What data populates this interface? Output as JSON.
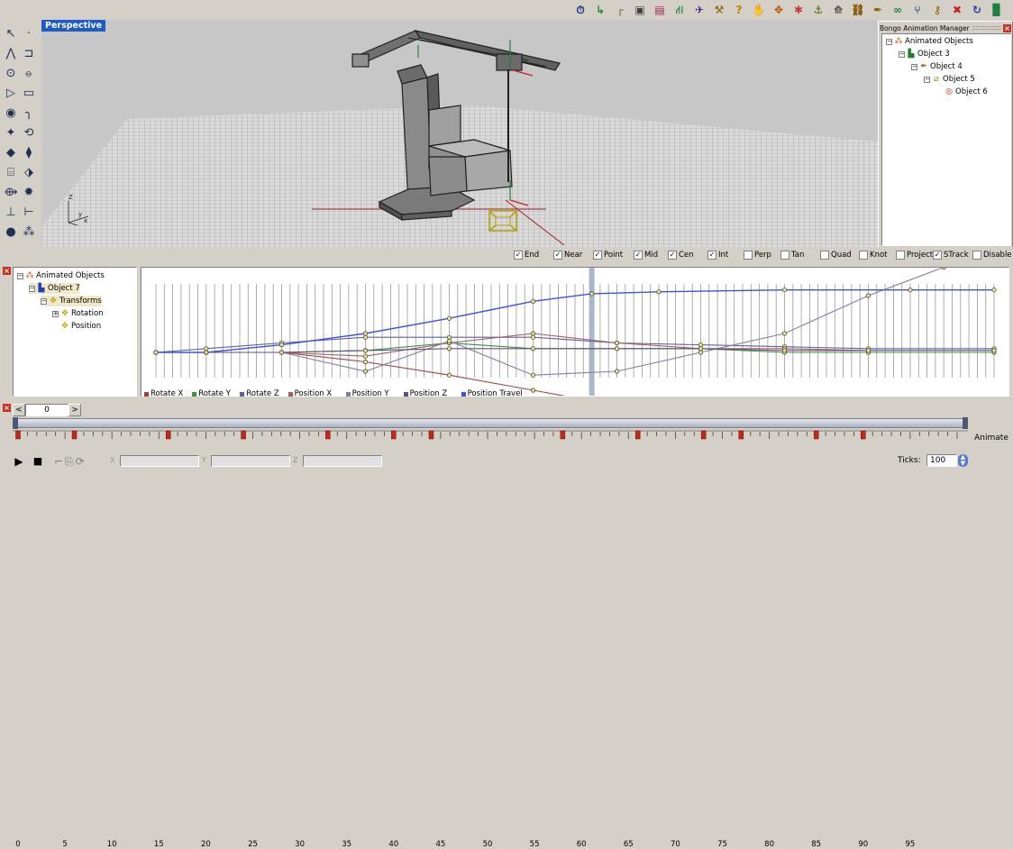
{
  "viewport": {
    "label": "Perspective",
    "axes": {
      "z": "Z",
      "y": "y",
      "x": "x"
    }
  },
  "toolbar": {
    "icons": [
      {
        "name": "stopwatch-icon",
        "glyph": "⏱",
        "color": "#203080"
      },
      {
        "name": "curve-tool-icon",
        "glyph": "↳",
        "color": "#208030"
      },
      {
        "name": "pipe-icon",
        "glyph": "┌",
        "color": "#806020"
      },
      {
        "name": "window-icon",
        "glyph": "▣",
        "color": "#404040"
      },
      {
        "name": "book-icon",
        "glyph": "▤",
        "color": "#a02060"
      },
      {
        "name": "hierarchy-icon",
        "glyph": "⛙",
        "color": "#208030"
      },
      {
        "name": "camera-icon",
        "glyph": "✈",
        "color": "#402080"
      },
      {
        "name": "wrench-icon",
        "glyph": "⚒",
        "color": "#806000"
      },
      {
        "name": "help-icon",
        "glyph": "?",
        "color": "#c08000"
      },
      {
        "name": "hand-icon",
        "glyph": "✋",
        "color": "#c08000"
      },
      {
        "name": "pivot-icon",
        "glyph": "✥",
        "color": "#c05000"
      },
      {
        "name": "bones-icon",
        "glyph": "✱",
        "color": "#c04040"
      },
      {
        "name": "arm-icon",
        "glyph": "⚓",
        "color": "#406000"
      },
      {
        "name": "ik-icon",
        "glyph": "⟰",
        "color": "#404040"
      },
      {
        "name": "chain-icon",
        "glyph": "⛓",
        "color": "#805000"
      },
      {
        "name": "pen-icon",
        "glyph": "✒",
        "color": "#806000"
      },
      {
        "name": "path-icon",
        "glyph": "∞",
        "color": "#208040"
      },
      {
        "name": "branch-icon",
        "glyph": "⑂",
        "color": "#406080"
      },
      {
        "name": "key-icon",
        "glyph": "⚷",
        "color": "#806000"
      },
      {
        "name": "delete-icon",
        "glyph": "✖",
        "color": "#c02020"
      },
      {
        "name": "refresh-icon",
        "glyph": "↻",
        "color": "#2040a0"
      },
      {
        "name": "save-icon",
        "glyph": "▉",
        "color": "#208040"
      }
    ]
  },
  "tools": {
    "icons": [
      {
        "name": "select-arrow-icon",
        "glyph": "↖"
      },
      {
        "name": "point-icon",
        "glyph": "·"
      },
      {
        "name": "polyline-icon",
        "glyph": "⋀"
      },
      {
        "name": "curve-points-icon",
        "glyph": "⊐"
      },
      {
        "name": "circle-icon",
        "glyph": "⊙"
      },
      {
        "name": "ellipse-icon",
        "glyph": "⦵"
      },
      {
        "name": "polygon-icon",
        "glyph": "▷"
      },
      {
        "name": "rectangle-icon",
        "glyph": "▭"
      },
      {
        "name": "arc-icon",
        "glyph": "◉"
      },
      {
        "name": "fillet-icon",
        "glyph": "╮"
      },
      {
        "name": "surface-icon",
        "glyph": "✦"
      },
      {
        "name": "revolve-icon",
        "glyph": "⟲"
      },
      {
        "name": "box-icon",
        "glyph": "◆"
      },
      {
        "name": "extrude-icon",
        "glyph": "⧫"
      },
      {
        "name": "cylinder-icon",
        "glyph": "⌸"
      },
      {
        "name": "mesh-icon",
        "glyph": "⬗"
      },
      {
        "name": "transform-icon",
        "glyph": "⟴"
      },
      {
        "name": "explode-icon",
        "glyph": "✹"
      },
      {
        "name": "split-icon",
        "glyph": "⊥"
      },
      {
        "name": "join-icon",
        "glyph": "⊢"
      },
      {
        "name": "sphere-icon",
        "glyph": "●"
      },
      {
        "name": "group-icon",
        "glyph": "⁂"
      }
    ]
  },
  "bongo": {
    "title": "Bongo Animation Manager",
    "tree": [
      {
        "label": "Animated Objects",
        "level": 0,
        "expander": "−",
        "icon": "⁂",
        "icon_color": "#c05020"
      },
      {
        "label": "Object 3",
        "level": 1,
        "expander": "−",
        "icon": "▙",
        "icon_color": "#208030"
      },
      {
        "label": "Object 4",
        "level": 2,
        "expander": "−",
        "icon": "✒",
        "icon_color": "#c04000"
      },
      {
        "label": "Object 5",
        "level": 3,
        "expander": "−",
        "icon": "⧄",
        "icon_color": "#808000"
      },
      {
        "label": "Object 6",
        "level": 4,
        "expander": "",
        "icon": "◎",
        "icon_color": "#c02020"
      }
    ]
  },
  "snap": {
    "items": [
      {
        "label": "End",
        "checked": true
      },
      {
        "label": "Near",
        "checked": true
      },
      {
        "label": "Point",
        "checked": true
      },
      {
        "label": "Mid",
        "checked": true
      },
      {
        "label": "Cen",
        "checked": true
      },
      {
        "label": "Int",
        "checked": true
      },
      {
        "label": "Perp",
        "checked": false
      },
      {
        "label": "Tan",
        "checked": false
      },
      {
        "label": "Quad",
        "checked": false
      },
      {
        "label": "Knot",
        "checked": false
      },
      {
        "label": "Project",
        "checked": false
      },
      {
        "label": "STrack",
        "checked": true
      },
      {
        "label": "Disable",
        "checked": false
      }
    ]
  },
  "anim_tree": [
    {
      "label": "Animated Objects",
      "level": 0,
      "expander": "−",
      "icon": "⁂",
      "icon_color": "#c05020"
    },
    {
      "label": "Object 7",
      "level": 1,
      "expander": "−",
      "icon": "▙",
      "icon_color": "#2040c0"
    },
    {
      "label": "Transforms",
      "level": 2,
      "expander": "−",
      "icon": "✥",
      "icon_color": "#c0a000"
    },
    {
      "label": "Rotation",
      "level": 3,
      "expander": "+",
      "icon": "✥",
      "icon_color": "#c0a000"
    },
    {
      "label": "Position",
      "level": 3,
      "expander": "",
      "icon": "✥",
      "icon_color": "#c0a000"
    }
  ],
  "chart_data": {
    "type": "line",
    "xlim": [
      0,
      100
    ],
    "legend_position": "bottom-left",
    "series": [
      {
        "name": "Rotate X",
        "color": "#a04040",
        "points": [
          [
            0,
            0
          ],
          [
            6,
            0
          ],
          [
            15,
            0
          ],
          [
            25,
            -0.05
          ],
          [
            35,
            -0.12
          ],
          [
            45,
            -0.2
          ],
          [
            55,
            -0.28
          ],
          [
            65,
            -0.33
          ],
          [
            75,
            -0.36
          ],
          [
            85,
            -0.37
          ],
          [
            100,
            -0.37
          ]
        ]
      },
      {
        "name": "Rotate Y",
        "color": "#409040",
        "points": [
          [
            0,
            0
          ],
          [
            6,
            0
          ],
          [
            15,
            0
          ],
          [
            25,
            0.01
          ],
          [
            35,
            0.05
          ],
          [
            45,
            0.02
          ],
          [
            55,
            0.02
          ],
          [
            65,
            0.02
          ],
          [
            75,
            0
          ],
          [
            85,
            0
          ],
          [
            100,
            0
          ]
        ]
      },
      {
        "name": "Rotate Z",
        "color": "#6060a0",
        "points": [
          [
            0,
            0
          ],
          [
            6,
            0.02
          ],
          [
            15,
            0.05
          ],
          [
            25,
            0.08
          ],
          [
            35,
            0.08
          ],
          [
            45,
            0.08
          ],
          [
            55,
            0.05
          ],
          [
            65,
            0.04
          ],
          [
            75,
            0.03
          ],
          [
            85,
            0.02
          ],
          [
            100,
            0.02
          ]
        ]
      },
      {
        "name": "Position X",
        "color": "#a06060",
        "points": [
          [
            0,
            0
          ],
          [
            6,
            0
          ],
          [
            15,
            0
          ],
          [
            25,
            -0.02
          ],
          [
            35,
            0.05
          ],
          [
            45,
            0.1
          ],
          [
            55,
            0.05
          ],
          [
            65,
            0.02
          ],
          [
            75,
            0.02
          ],
          [
            85,
            0.01
          ],
          [
            100,
            0.01
          ]
        ]
      },
      {
        "name": "Position Y",
        "color": "#8080a0",
        "points": [
          [
            0,
            0
          ],
          [
            6,
            0
          ],
          [
            15,
            0
          ],
          [
            25,
            -0.1
          ],
          [
            35,
            0.06
          ],
          [
            45,
            -0.12
          ],
          [
            55,
            -0.1
          ],
          [
            65,
            0
          ],
          [
            75,
            0.1
          ],
          [
            85,
            0.3
          ],
          [
            94,
            0.45
          ]
        ]
      },
      {
        "name": "Position Z",
        "color": "#605080",
        "points": [
          [
            0,
            0
          ],
          [
            6,
            0
          ],
          [
            15,
            0
          ],
          [
            25,
            0.01
          ],
          [
            35,
            0.02
          ],
          [
            45,
            0.02
          ],
          [
            55,
            0.02
          ],
          [
            65,
            0.02
          ],
          [
            75,
            0.01
          ],
          [
            85,
            0.01
          ],
          [
            100,
            0.01
          ]
        ]
      },
      {
        "name": "Position Travel",
        "color": "#4050e0",
        "points": [
          [
            0,
            0
          ],
          [
            6,
            0
          ],
          [
            15,
            0.04
          ],
          [
            25,
            0.1
          ],
          [
            35,
            0.18
          ],
          [
            45,
            0.27
          ],
          [
            52,
            0.31
          ],
          [
            60,
            0.32
          ],
          [
            75,
            0.33
          ],
          [
            90,
            0.33
          ],
          [
            100,
            0.33
          ]
        ]
      }
    ]
  },
  "timeline": {
    "current_frame": "0",
    "prev_label": "<",
    "next_label": ">",
    "tick_labels": [
      "0",
      "5",
      "10",
      "15",
      "20",
      "25",
      "30",
      "35",
      "40",
      "45",
      "50",
      "55",
      "60",
      "65",
      "70",
      "75",
      "80",
      "85",
      "90",
      "95"
    ],
    "keyframes": [
      0,
      6,
      16,
      24,
      33,
      40,
      44,
      58,
      66,
      73,
      77,
      85,
      90
    ],
    "animate_label": "Animate",
    "ticks_label": "Ticks:",
    "ticks_value": "100",
    "play_glyph": "▶",
    "stop_glyph": "■",
    "coord_x": "X",
    "coord_y": "Y",
    "coord_z": "Z"
  }
}
